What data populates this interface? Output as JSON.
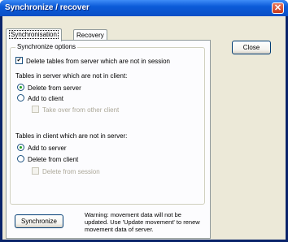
{
  "window": {
    "title": "Synchronize / recover",
    "close_glyph": "✕"
  },
  "tabs": [
    {
      "label": "Synchronisation",
      "active": true
    },
    {
      "label": "Recovery",
      "active": false
    }
  ],
  "close_button": {
    "label": "Close"
  },
  "sync_options": {
    "group_label": "Synchronize options",
    "delete_tables": {
      "label": "Delete tables from server which are not in session",
      "checked": true
    },
    "server_section": {
      "heading": "Tables in server which are not in client:",
      "delete_from_server": {
        "label": "Delete from server",
        "selected": true
      },
      "add_to_client": {
        "label": "Add to client",
        "selected": false
      },
      "take_over": {
        "label": "Take over from other client",
        "checked": false,
        "enabled": false
      }
    },
    "client_section": {
      "heading": "Tables in client which are not in server:",
      "add_to_server": {
        "label": "Add to server",
        "selected": true
      },
      "delete_from_client": {
        "label": "Delete from client",
        "selected": false
      },
      "delete_from_session": {
        "label": "Delete from session",
        "checked": false,
        "enabled": false
      }
    }
  },
  "synchronize_button": {
    "label": "Synchronize"
  },
  "warning_text": "Warning: movement data will not be updated. Use 'Update movement' to renew movement data of server.",
  "colors": {
    "titlebar": "#0b5bd8",
    "dialog_bg": "#ece9d8",
    "radio_dot": "#21a121"
  }
}
